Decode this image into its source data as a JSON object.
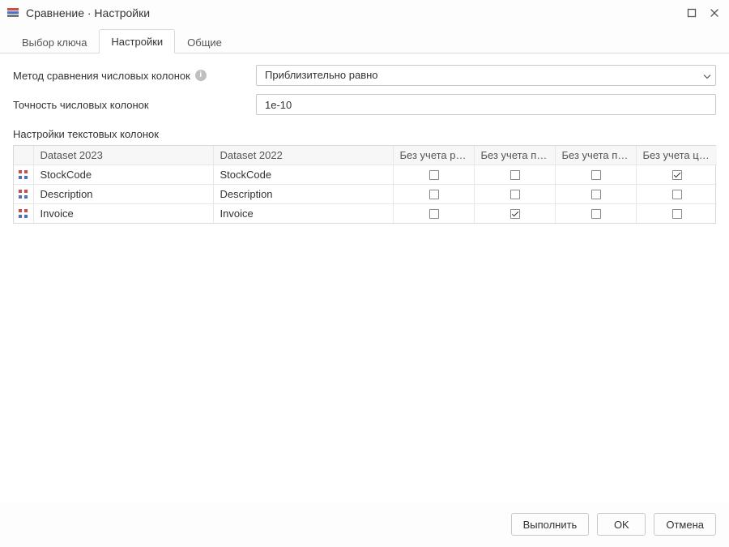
{
  "window": {
    "title": "Сравнение · Настройки"
  },
  "tabs": [
    {
      "label": "Выбор ключа",
      "active": false
    },
    {
      "label": "Настройки",
      "active": true
    },
    {
      "label": "Общие",
      "active": false
    }
  ],
  "settings": {
    "method_label": "Метод сравнения числовых колонок",
    "method_value": "Приблизительно равно",
    "precision_label": "Точность числовых колонок",
    "precision_value": "1e-10",
    "text_columns_title": "Настройки текстовых колонок"
  },
  "table": {
    "headers": {
      "icon": "",
      "dataset_a": "Dataset 2023",
      "dataset_b": "Dataset 2022",
      "ignore_case": "Без учета ре...",
      "ignore_spaces": "Без учета пу...",
      "ignore_punct": "Без учета пр...",
      "ignore_digits": "Без учета ци..."
    },
    "rows": [
      {
        "a": "StockCode",
        "b": "StockCode",
        "ignore_case": false,
        "ignore_spaces": false,
        "ignore_punct": false,
        "ignore_digits": true
      },
      {
        "a": "Description",
        "b": "Description",
        "ignore_case": false,
        "ignore_spaces": false,
        "ignore_punct": false,
        "ignore_digits": false
      },
      {
        "a": "Invoice",
        "b": "Invoice",
        "ignore_case": false,
        "ignore_spaces": true,
        "ignore_punct": false,
        "ignore_digits": false
      }
    ]
  },
  "buttons": {
    "execute": "Выполнить",
    "ok": "OK",
    "cancel": "Отмена"
  },
  "icons": {
    "info_glyph": "i"
  }
}
